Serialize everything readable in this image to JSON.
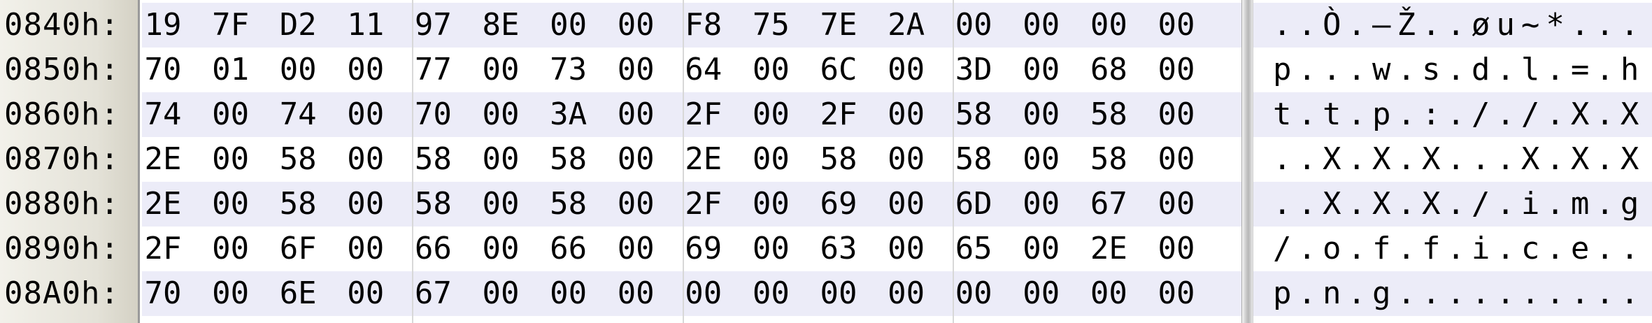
{
  "rows": [
    {
      "offset": "0840h:",
      "bytes": [
        "19",
        "7F",
        "D2",
        "11",
        "97",
        "8E",
        "00",
        "00",
        "F8",
        "75",
        "7E",
        "2A",
        "00",
        "00",
        "00",
        "00"
      ],
      "ascii": "..Ò.—Ž..øu~*...."
    },
    {
      "offset": "0850h:",
      "bytes": [
        "70",
        "01",
        "00",
        "00",
        "77",
        "00",
        "73",
        "00",
        "64",
        "00",
        "6C",
        "00",
        "3D",
        "00",
        "68",
        "00"
      ],
      "ascii": "p...w.s.d.l.=.h."
    },
    {
      "offset": "0860h:",
      "bytes": [
        "74",
        "00",
        "74",
        "00",
        "70",
        "00",
        "3A",
        "00",
        "2F",
        "00",
        "2F",
        "00",
        "58",
        "00",
        "58",
        "00"
      ],
      "ascii": "t.t.p.:././.X.X."
    },
    {
      "offset": "0870h:",
      "bytes": [
        "2E",
        "00",
        "58",
        "00",
        "58",
        "00",
        "58",
        "00",
        "2E",
        "00",
        "58",
        "00",
        "58",
        "00",
        "58",
        "00"
      ],
      "ascii": "..X.X.X...X.X.X."
    },
    {
      "offset": "0880h:",
      "bytes": [
        "2E",
        "00",
        "58",
        "00",
        "58",
        "00",
        "58",
        "00",
        "2F",
        "00",
        "69",
        "00",
        "6D",
        "00",
        "67",
        "00"
      ],
      "ascii": "..X.X.X./.i.m.g."
    },
    {
      "offset": "0890h:",
      "bytes": [
        "2F",
        "00",
        "6F",
        "00",
        "66",
        "00",
        "66",
        "00",
        "69",
        "00",
        "63",
        "00",
        "65",
        "00",
        "2E",
        "00"
      ],
      "ascii": "/.o.f.f.i.c.e..."
    },
    {
      "offset": "08A0h:",
      "bytes": [
        "70",
        "00",
        "6E",
        "00",
        "67",
        "00",
        "00",
        "00",
        "00",
        "00",
        "00",
        "00",
        "00",
        "00",
        "00",
        "00"
      ],
      "ascii": "p.n.g..........."
    }
  ],
  "colors": {
    "row_band": "#ececf8",
    "offset_bg": "#e4e2d8",
    "group_separator": "#d8d8d8"
  }
}
